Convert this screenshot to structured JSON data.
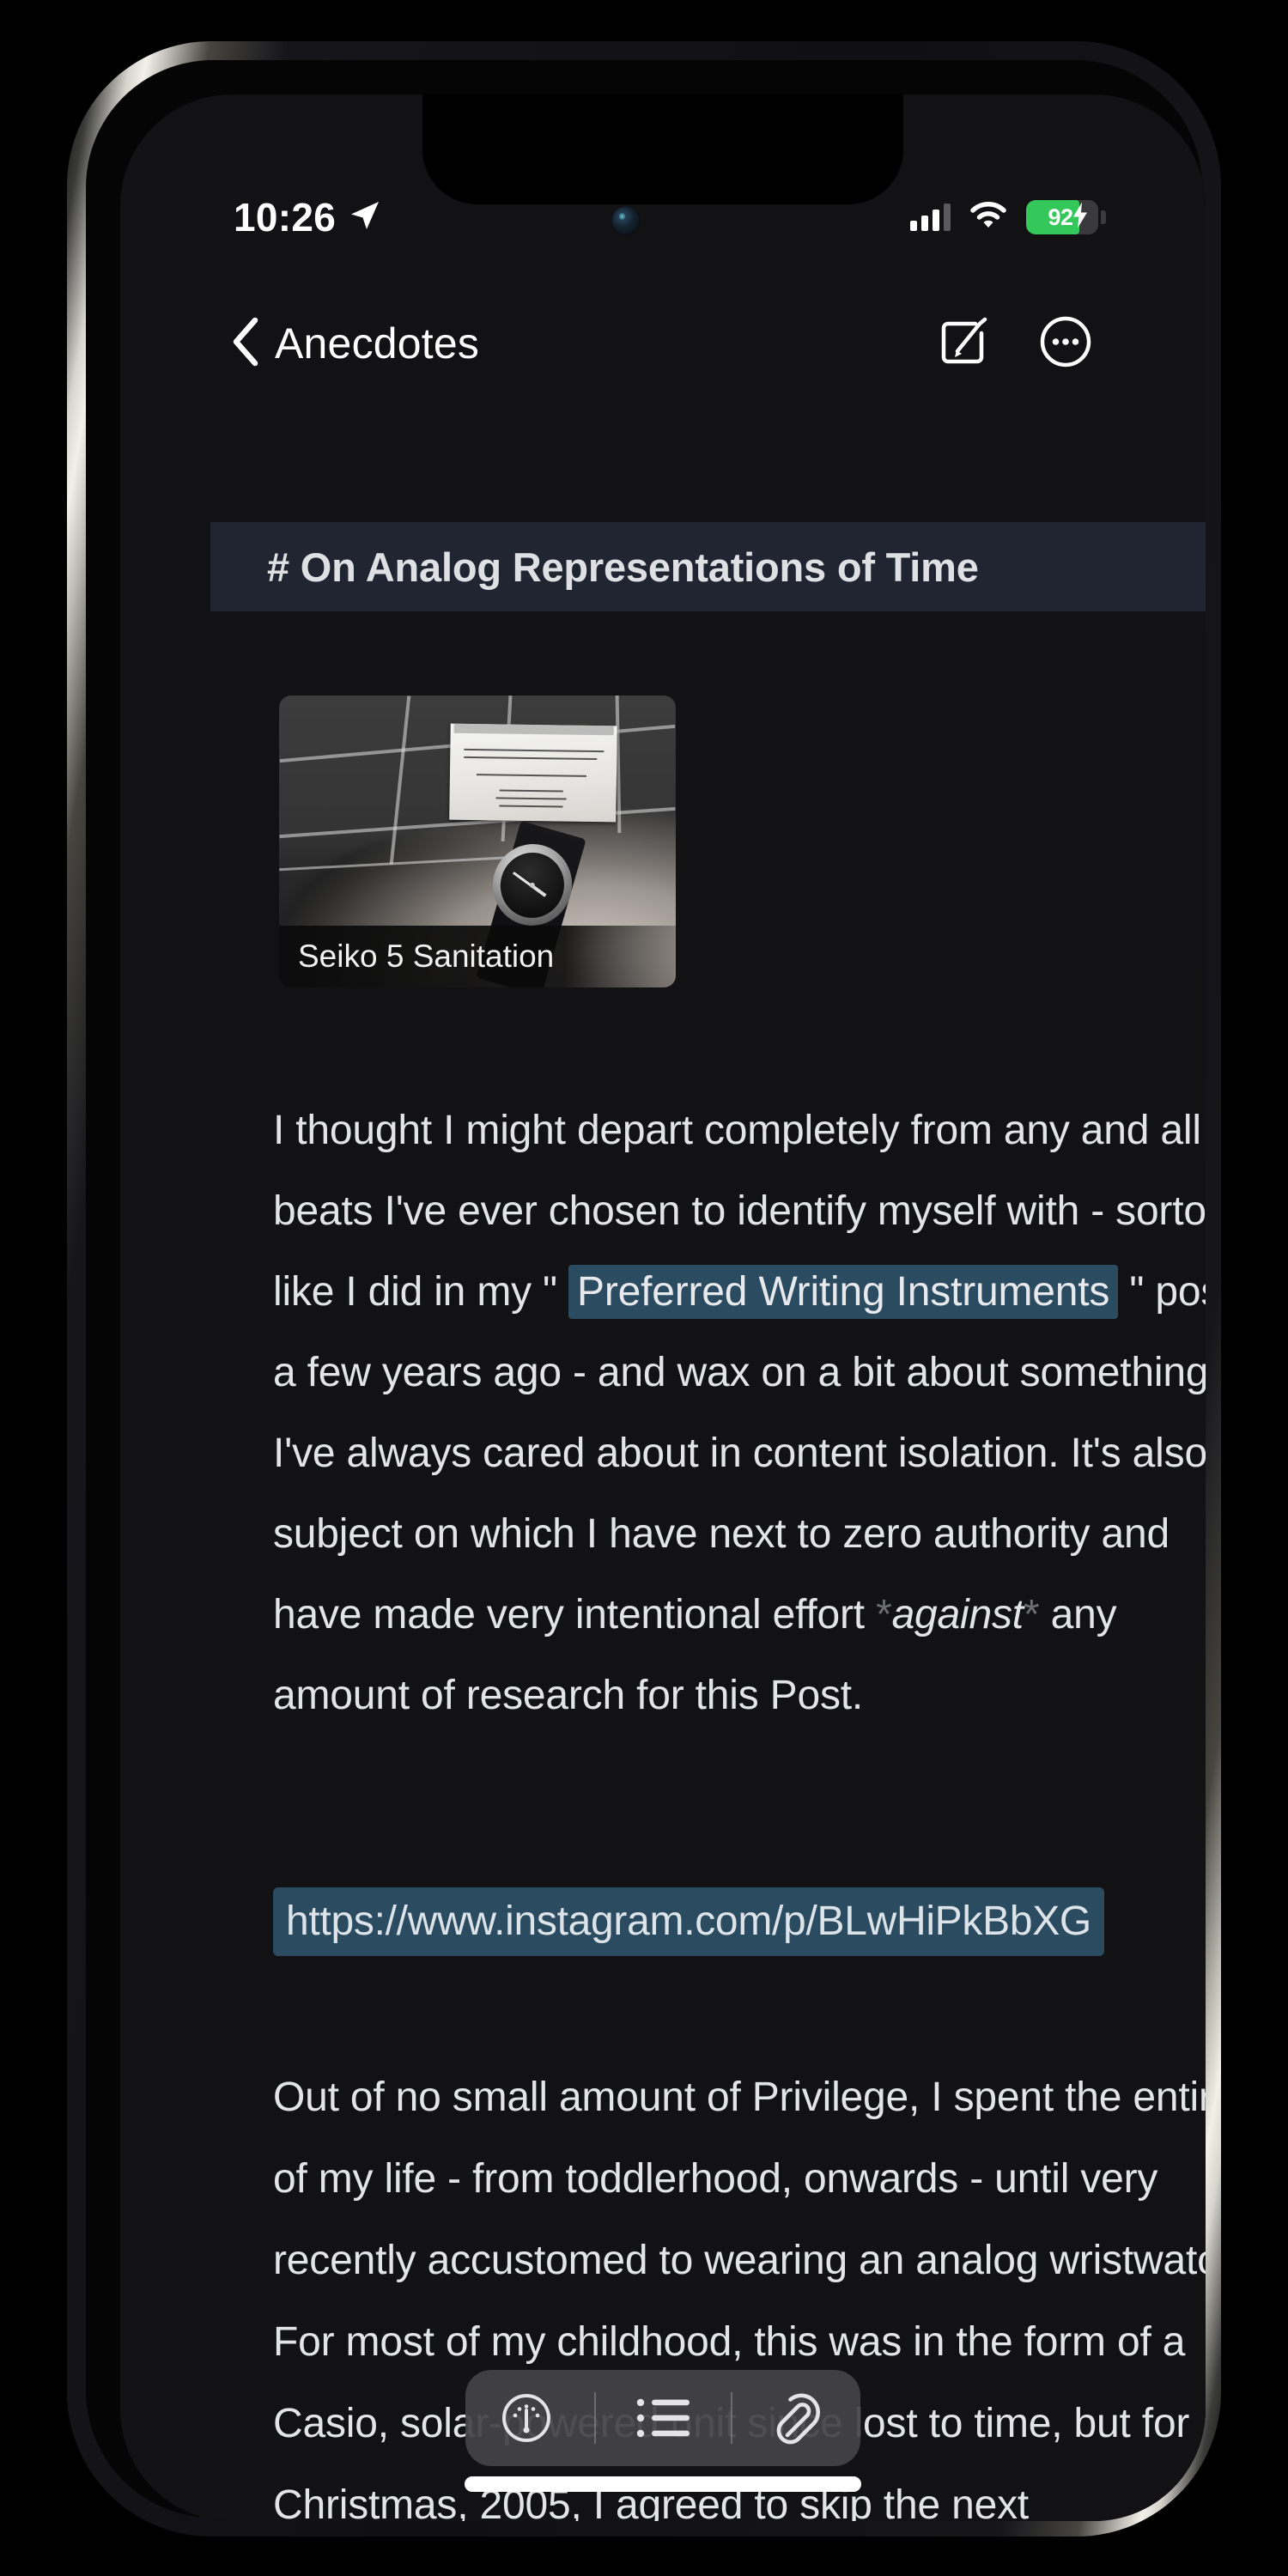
{
  "status_bar": {
    "time": "10:26",
    "location_icon": "location-arrow-icon",
    "cellular_icon": "cellular-signal-icon",
    "wifi_icon": "wifi-icon",
    "battery_percent": "92",
    "battery_level": 92,
    "battery_charging": true,
    "battery_color": "#34c759"
  },
  "nav_bar": {
    "back_label": "Anecdotes",
    "back_icon": "chevron-left-icon",
    "compose_icon": "compose-icon",
    "more_icon": "ellipsis-circle-icon"
  },
  "note": {
    "title": "# On Analog Representations of Time",
    "title_background": "#212431",
    "attachment": {
      "caption": "Seiko 5 Sanitation",
      "description": "black and white photo of a wrist wearing a Seiko 5 watch in front of a tiled restroom wall with a posted sign"
    },
    "paragraph_1": {
      "segment_1": "I thought I might depart completely from any and all beats I've ever chosen to identify myself with - sortof like I did in my \" ",
      "link_text": "Preferred Writing Instruments",
      "segment_2": " \" post a few years ago - and wax on a bit about something I've always cared about in content isolation. It's also a subject on which I have next to zero authority and have made very intentional effort ",
      "emphasis_open": "*",
      "emphasis_text": "against",
      "emphasis_close": "*",
      "segment_3": " any amount of research for this Post."
    },
    "url": "https://www.instagram.com/p/BLwHiPkBbXG",
    "paragraph_2": "Out of no small amount of Privilege, I spent the entirety of my life - from toddlerhood, onwards - until very recently accustomed to wearing an analog wristwatch. For most of my childhood, this was in the form of a Casio, solar-powered unit since lost to time, but for Christmas, 2005, I agreed to skip the next",
    "link_highlight_color": "#2b4b60"
  },
  "format_toolbar": {
    "gauge_icon": "gauge-icon",
    "list_icon": "bullet-list-icon",
    "attach_icon": "paperclip-icon"
  },
  "device": {
    "silent_switch": "silent-switch",
    "volume_up": "volume-up-button",
    "volume_down": "volume-down-button",
    "power": "power-button",
    "home_indicator": "home-indicator"
  }
}
